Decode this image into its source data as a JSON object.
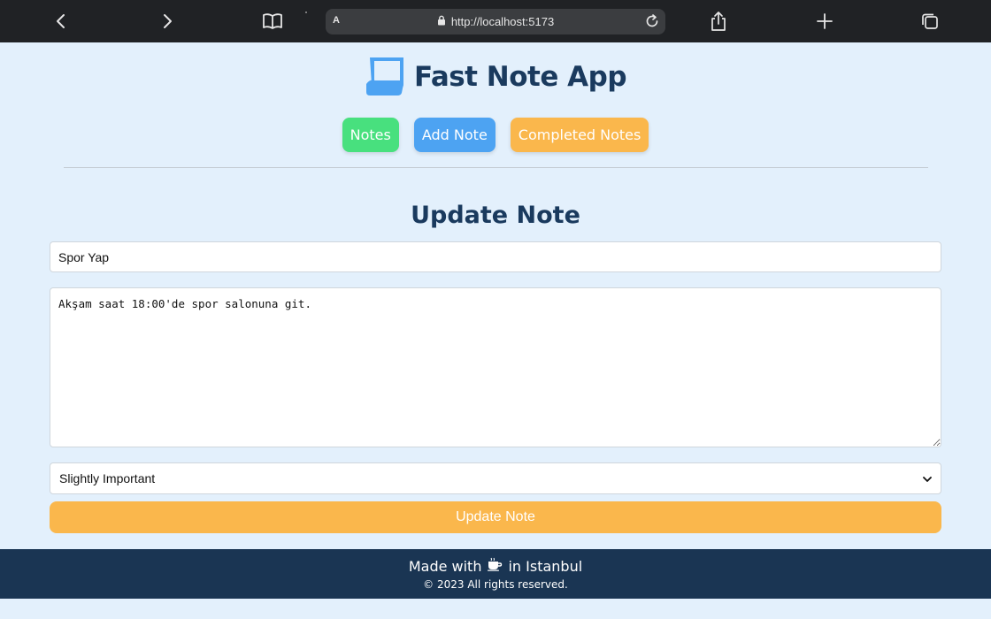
{
  "browser": {
    "address_prefix": "A",
    "url": "http://localhost:5173",
    "icons": [
      "back-icon",
      "forward-icon",
      "reader-icon",
      "lock-icon",
      "reload-icon",
      "share-icon",
      "new-tab-icon",
      "tabs-icon"
    ]
  },
  "header": {
    "app_title": "Fast Note App",
    "logo_icon": "note-scroll-icon"
  },
  "nav": {
    "notes": "Notes",
    "add_note": "Add Note",
    "completed_notes": "Completed Notes"
  },
  "form": {
    "heading": "Update Note",
    "title_value": "Spor Yap",
    "body_value": "Akşam saat 18:00'de spor salonuna git.",
    "priority_value": "Slightly Important",
    "submit_label": "Update Note"
  },
  "footer": {
    "made_prefix": "Made with",
    "made_icon": "coffee-icon",
    "made_suffix": "in Istanbul",
    "rights": "© 2023 All rights reserved."
  },
  "colors": {
    "page_bg": "#e3f0fc",
    "brand": "#1a3a5e",
    "notes_btn": "#48e07e",
    "add_btn": "#4da3f2",
    "completed_btn": "#fab74c",
    "footer_bg": "#1a3553"
  }
}
